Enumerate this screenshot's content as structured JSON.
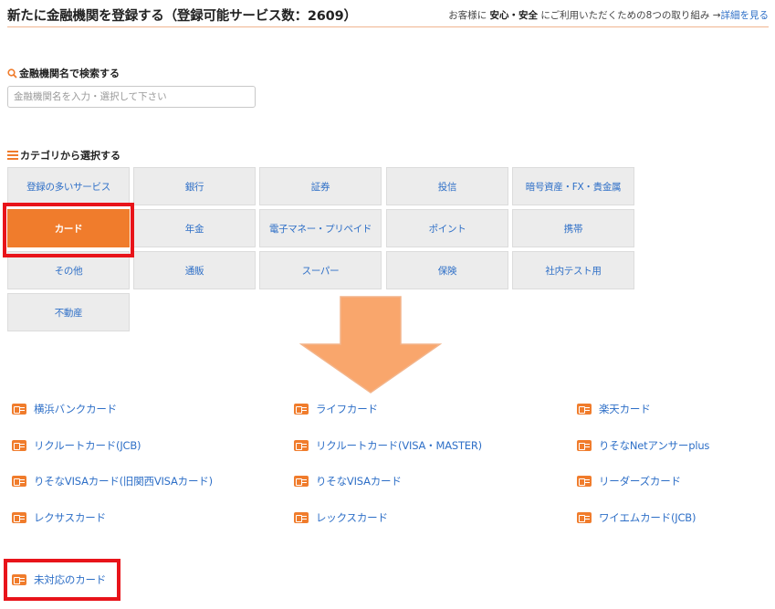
{
  "header": {
    "title": "新たに金融機関を登録する（登録可能サービス数：2609）",
    "notice_prefix": "お客様に",
    "notice_emphasis": "安心・安全",
    "notice_suffix": "にご利用いただくための8つの取り組み →",
    "details_link": "詳細を見る"
  },
  "search": {
    "label": "金融機関名で検索する",
    "placeholder": "金融機関名を入力・選択して下さい",
    "value": ""
  },
  "categories": {
    "label": "カテゴリから選択する",
    "items": [
      "登録の多いサービス",
      "銀行",
      "証券",
      "投信",
      "暗号資産・FX・貴金属",
      "カード",
      "年金",
      "電子マネー・プリペイド",
      "ポイント",
      "携帯",
      "その他",
      "通販",
      "スーパー",
      "保険",
      "社内テスト用",
      "不動産"
    ],
    "selected": "カード"
  },
  "cards": {
    "items": [
      "横浜バンクカード",
      "ライフカード",
      "楽天カード",
      "リクルートカード(JCB)",
      "リクルートカード(VISA・MASTER)",
      "りそなNetアンサーplus",
      "りそなVISAカード(旧関西VISAカード)",
      "りそなVISAカード",
      "リーダーズカード",
      "レクサスカード",
      "レックスカード",
      "ワイエムカード(JCB)"
    ],
    "unsupported": "未対応のカード"
  },
  "colors": {
    "accent": "#f07c2c",
    "link": "#2e6fc7",
    "highlight": "#e8141a",
    "arrow": "#f9a66c"
  }
}
